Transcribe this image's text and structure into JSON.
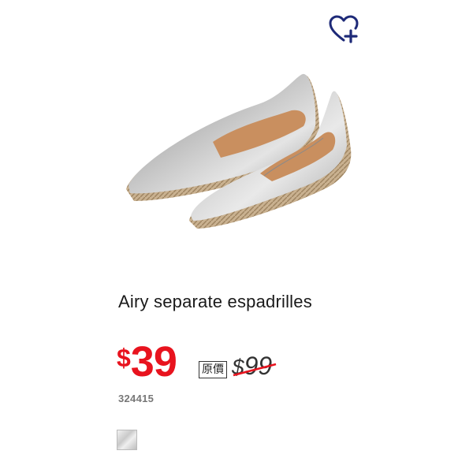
{
  "product": {
    "name": "Airy separate espadrilles",
    "sale_price_currency": "$",
    "sale_price_amount": "39",
    "original_price_badge": "原價",
    "original_price_currency": "$",
    "original_price_amount": "99",
    "code": "324415",
    "image_icon": "product-photo-silver-espadrilles",
    "swatch_color": "silver"
  },
  "actions": {
    "favorite_icon": "heart-plus-icon"
  },
  "colors": {
    "sale": "#e8131e",
    "favorite_icon": "#1e2a78",
    "text": "#1a1a1a",
    "code": "#777777"
  }
}
